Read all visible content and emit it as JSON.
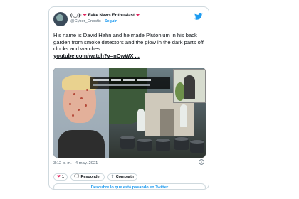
{
  "tweet": {
    "display_name_prefix": "(·‿•)◦",
    "display_name": "Fake News Enthusiast",
    "handle": "@Cyber_Gnostic",
    "separator": "·",
    "follow_label": "Seguir",
    "text": "His name is David Hahn and he made Plutonium in his back garden from smoke detectors and the glow in the dark parts off clocks and watches",
    "link_text": "youtube.com/watch?v=nCwWX ...",
    "timestamp": "3:12 p. m. · 4 may. 2021",
    "like_count": "1",
    "reply_label": "Responder",
    "share_label": "Compartir",
    "discover_label": "Descubre lo que está pasando en Twitter"
  },
  "icons": {
    "brand": "twitter-bird-icon",
    "heart": "heart-icon",
    "reply": "reply-icon",
    "share": "share-icon",
    "info": "info-icon"
  },
  "colors": {
    "brand_blue": "#1d9bf0",
    "like_red": "#e0245e",
    "border": "#cfd9de",
    "secondary_text": "#536471"
  }
}
